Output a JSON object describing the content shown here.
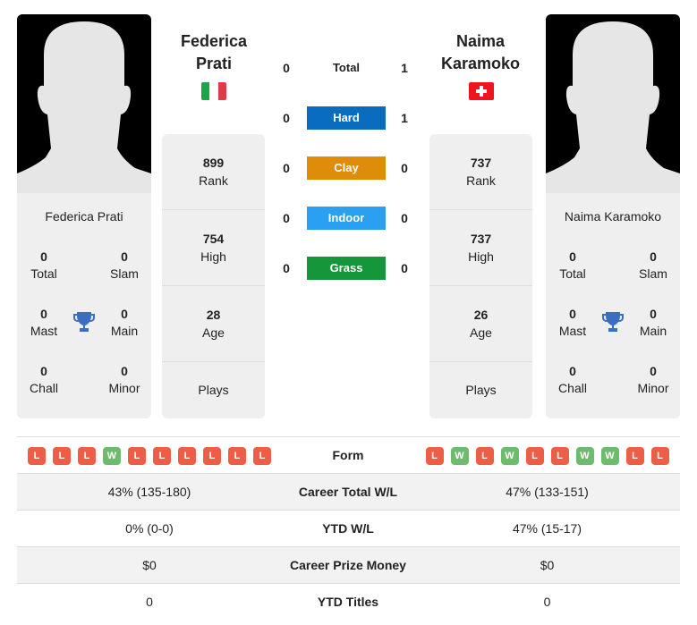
{
  "colors": {
    "hard": "#0a6cbf",
    "clay": "#de8c0a",
    "indoor": "#2b9ff2",
    "grass": "#15963a",
    "loss": "#ec5f46",
    "win": "#6dbb6d",
    "trophy": "#3a6fbf"
  },
  "player1": {
    "name_line1": "Federica",
    "name_line2": "Prati",
    "full_name": "Federica Prati",
    "flag": "italy-flag",
    "rank": "899",
    "rank_label": "Rank",
    "high": "754",
    "high_label": "High",
    "age": "28",
    "age_label": "Age",
    "plays_label": "Plays",
    "titles": {
      "total": "0",
      "total_label": "Total",
      "slam": "0",
      "slam_label": "Slam",
      "mast": "0",
      "mast_label": "Mast",
      "main": "0",
      "main_label": "Main",
      "chall": "0",
      "chall_label": "Chall",
      "minor": "0",
      "minor_label": "Minor"
    },
    "form": [
      "L",
      "L",
      "L",
      "W",
      "L",
      "L",
      "L",
      "L",
      "L",
      "L"
    ]
  },
  "player2": {
    "name_line1": "Naima",
    "name_line2": "Karamoko",
    "full_name": "Naima Karamoko",
    "flag": "switzerland-flag",
    "rank": "737",
    "rank_label": "Rank",
    "high": "737",
    "high_label": "High",
    "age": "26",
    "age_label": "Age",
    "plays_label": "Plays",
    "titles": {
      "total": "0",
      "total_label": "Total",
      "slam": "0",
      "slam_label": "Slam",
      "mast": "0",
      "mast_label": "Mast",
      "main": "0",
      "main_label": "Main",
      "chall": "0",
      "chall_label": "Chall",
      "minor": "0",
      "minor_label": "Minor"
    },
    "form": [
      "L",
      "W",
      "L",
      "W",
      "L",
      "L",
      "W",
      "W",
      "L",
      "L"
    ]
  },
  "h2h": {
    "total": {
      "label": "Total",
      "p1": "0",
      "p2": "1"
    },
    "hard": {
      "label": "Hard",
      "p1": "0",
      "p2": "1"
    },
    "clay": {
      "label": "Clay",
      "p1": "0",
      "p2": "0"
    },
    "indoor": {
      "label": "Indoor",
      "p1": "0",
      "p2": "0"
    },
    "grass": {
      "label": "Grass",
      "p1": "0",
      "p2": "0"
    }
  },
  "table": {
    "form_label": "Form",
    "rows": [
      {
        "label": "Career Total W/L",
        "p1": "43% (135-180)",
        "p2": "47% (133-151)"
      },
      {
        "label": "YTD W/L",
        "p1": "0% (0-0)",
        "p2": "47% (15-17)"
      },
      {
        "label": "Career Prize Money",
        "p1": "$0",
        "p2": "$0"
      },
      {
        "label": "YTD Titles",
        "p1": "0",
        "p2": "0"
      }
    ]
  }
}
